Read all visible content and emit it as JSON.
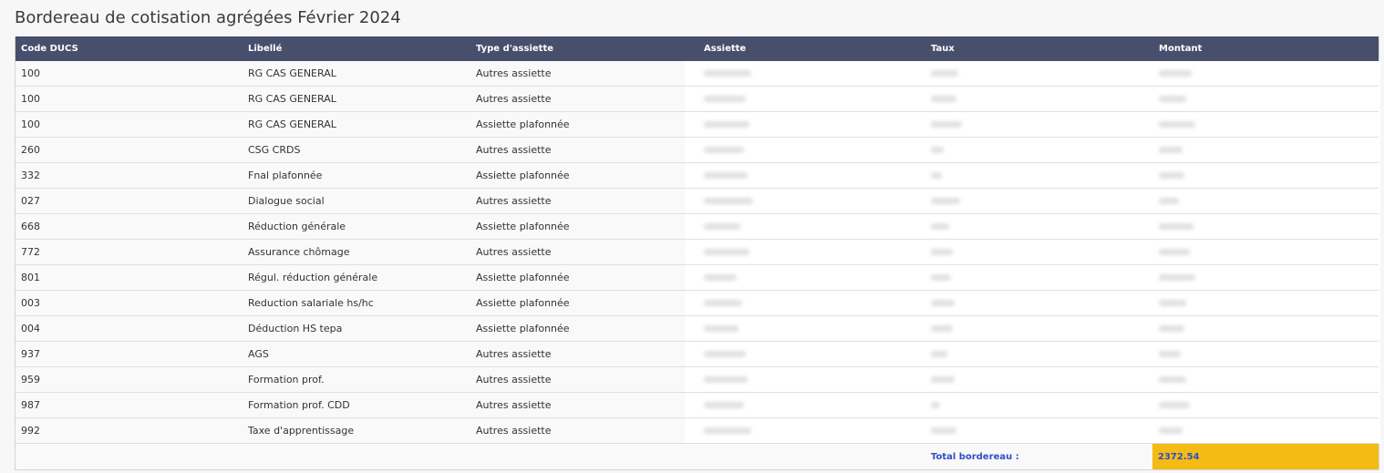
{
  "title": "Bordereau de cotisation agrégées Février 2024",
  "table": {
    "headers": [
      "Code DUCS",
      "Libellé",
      "Type d'assiette",
      "Assiette",
      "Taux",
      "Montant"
    ],
    "rows": [
      {
        "code": "100",
        "libelle": "RG CAS GENERAL",
        "type": "Autres assiette"
      },
      {
        "code": "100",
        "libelle": "RG CAS GENERAL",
        "type": "Autres assiette"
      },
      {
        "code": "100",
        "libelle": "RG CAS GENERAL",
        "type": "Assiette plafonnée"
      },
      {
        "code": "260",
        "libelle": "CSG CRDS",
        "type": "Autres assiette"
      },
      {
        "code": "332",
        "libelle": "Fnal plafonnée",
        "type": "Assiette plafonnée"
      },
      {
        "code": "027",
        "libelle": "Dialogue social",
        "type": "Autres assiette"
      },
      {
        "code": "668",
        "libelle": "Réduction générale",
        "type": "Assiette plafonnée"
      },
      {
        "code": "772",
        "libelle": "Assurance chômage",
        "type": "Autres assiette"
      },
      {
        "code": "801",
        "libelle": "Régul. réduction générale",
        "type": "Assiette plafonnée"
      },
      {
        "code": "003",
        "libelle": "Reduction salariale hs/hc",
        "type": "Assiette plafonnée"
      },
      {
        "code": "004",
        "libelle": "Déduction HS tepa",
        "type": "Assiette plafonnée"
      },
      {
        "code": "937",
        "libelle": "AGS",
        "type": "Autres assiette"
      },
      {
        "code": "959",
        "libelle": "Formation prof.",
        "type": "Autres assiette"
      },
      {
        "code": "987",
        "libelle": "Formation prof. CDD",
        "type": "Autres assiette"
      },
      {
        "code": "992",
        "libelle": "Taxe d'apprentissage",
        "type": "Autres assiette"
      }
    ],
    "total_label": "Total bordereau :",
    "total_value": "2372.54"
  },
  "colors": {
    "header_bg": "#474f6d",
    "total_bg": "#f3bb14",
    "total_text": "#2f4fc5"
  }
}
